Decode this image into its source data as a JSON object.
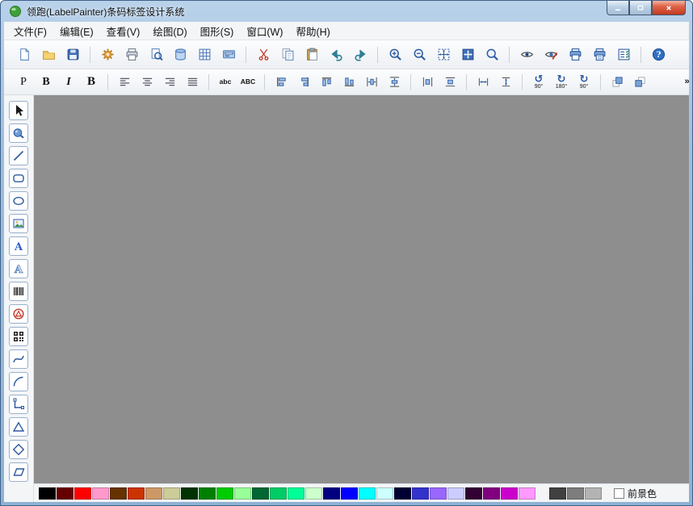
{
  "window": {
    "title": "领跑(LabelPainter)条码标签设计系统",
    "controls": [
      {
        "name": "minimize-button",
        "icon": "minimize"
      },
      {
        "name": "maximize-button",
        "icon": "maximize"
      },
      {
        "name": "close-button",
        "icon": "close"
      }
    ]
  },
  "chevron": {
    "glyph": "»"
  },
  "menu": {
    "items": [
      {
        "name": "menu-file",
        "label": "文件(F)"
      },
      {
        "name": "menu-edit",
        "label": "编辑(E)"
      },
      {
        "name": "menu-view",
        "label": "查看(V)"
      },
      {
        "name": "menu-draw",
        "label": "绘图(D)"
      },
      {
        "name": "menu-shape",
        "label": "图形(S)"
      },
      {
        "name": "menu-window",
        "label": "窗口(W)"
      },
      {
        "name": "menu-help",
        "label": "帮助(H)"
      }
    ]
  },
  "toolbar_main": {
    "groups": [
      [
        {
          "name": "new-button",
          "icon": "page"
        },
        {
          "name": "open-button",
          "icon": "folder"
        },
        {
          "name": "save-button",
          "icon": "floppy"
        }
      ],
      [
        {
          "name": "settings-button",
          "icon": "gear"
        },
        {
          "name": "print-button",
          "icon": "printer"
        },
        {
          "name": "print-preview-button",
          "icon": "preview"
        },
        {
          "name": "database-button",
          "icon": "database"
        },
        {
          "name": "grid-button",
          "icon": "grid"
        },
        {
          "name": "label-printer-button",
          "icon": "device"
        }
      ],
      [
        {
          "name": "cut-button",
          "icon": "cut"
        },
        {
          "name": "copy-button",
          "icon": "copy"
        },
        {
          "name": "paste-button",
          "icon": "paste"
        },
        {
          "name": "undo-button",
          "icon": "undo"
        },
        {
          "name": "redo-button",
          "icon": "redo"
        }
      ],
      [
        {
          "name": "zoom-in-button",
          "icon": "zoomin"
        },
        {
          "name": "zoom-out-button",
          "icon": "zoomout"
        },
        {
          "name": "fit-window-button",
          "icon": "fitwin"
        },
        {
          "name": "fit-page-button",
          "icon": "fitpage"
        },
        {
          "name": "zoom-tool-button",
          "icon": "zoom"
        }
      ],
      [
        {
          "name": "view-mode-button",
          "icon": "eye"
        },
        {
          "name": "edit-mode-button",
          "icon": "eyeedit"
        },
        {
          "name": "print-current-button",
          "icon": "printblue"
        },
        {
          "name": "print-batch-button",
          "icon": "printblue2"
        },
        {
          "name": "print-task-button",
          "icon": "tasklist"
        }
      ],
      [
        {
          "name": "help-button",
          "icon": "help"
        }
      ]
    ]
  },
  "toolbar_format": {
    "groups": [
      [
        {
          "name": "font-properties-button",
          "text": "P"
        },
        {
          "name": "bold-button",
          "text": "B",
          "style": "bold"
        },
        {
          "name": "italic-button",
          "text": "I",
          "style": "italic"
        },
        {
          "name": "black-bold-button",
          "text": "B",
          "style": "heavy"
        }
      ],
      [
        {
          "name": "align-left-button",
          "icon": "alignL"
        },
        {
          "name": "align-center-button",
          "icon": "alignC"
        },
        {
          "name": "align-right-button",
          "icon": "alignR"
        },
        {
          "name": "align-justify-button",
          "icon": "alignJ"
        }
      ],
      [
        {
          "name": "lowercase-button",
          "text": "abc",
          "style": "case"
        },
        {
          "name": "uppercase-button",
          "text": "ABC",
          "style": "case"
        }
      ],
      [
        {
          "name": "align-objects-left-button",
          "icon": "objL"
        },
        {
          "name": "align-objects-right-button",
          "icon": "objR"
        },
        {
          "name": "align-objects-top-button",
          "icon": "objT"
        },
        {
          "name": "align-objects-bottom-button",
          "icon": "objB"
        },
        {
          "name": "space-equal-horizontal-button",
          "icon": "spaceH"
        },
        {
          "name": "space-equal-vertical-button",
          "icon": "spaceV"
        }
      ],
      [
        {
          "name": "page-center-horizontal-button",
          "icon": "pageH"
        },
        {
          "name": "page-center-vertical-button",
          "icon": "pageV"
        }
      ],
      [
        {
          "name": "equal-width-button",
          "icon": "eqW"
        },
        {
          "name": "equal-height-button",
          "icon": "eqH"
        }
      ],
      [
        {
          "name": "rotate-left-90-button",
          "icon": "rotL",
          "label": "90°"
        },
        {
          "name": "rotate-180-button",
          "icon": "rot180",
          "label": "180°"
        },
        {
          "name": "rotate-right-90-button",
          "icon": "rotR",
          "label": "90°"
        }
      ],
      [
        {
          "name": "bring-to-front-button",
          "icon": "front"
        },
        {
          "name": "send-to-back-button",
          "icon": "back"
        }
      ]
    ]
  },
  "tools": {
    "items": [
      {
        "name": "select-tool",
        "icon": "cursor"
      },
      {
        "name": "rotate-tool",
        "icon": "blob"
      },
      {
        "name": "line-tool",
        "icon": "line"
      },
      {
        "name": "rounded-rect-tool",
        "icon": "roundrect"
      },
      {
        "name": "ellipse-tool",
        "icon": "ellipse"
      },
      {
        "name": "image-tool",
        "icon": "image"
      },
      {
        "name": "text-tool",
        "icon": "textA"
      },
      {
        "name": "art-text-tool",
        "icon": "artA"
      },
      {
        "name": "barcode-tool",
        "icon": "barcode"
      },
      {
        "name": "logo-tool",
        "icon": "logo"
      },
      {
        "name": "qrcode-tool",
        "icon": "qrcode"
      },
      {
        "name": "curve-tool",
        "icon": "curve"
      },
      {
        "name": "arc-tool",
        "icon": "arc"
      },
      {
        "name": "polyline-tool",
        "icon": "polyline"
      },
      {
        "name": "triangle-tool",
        "icon": "triangle"
      },
      {
        "name": "diamond-tool",
        "icon": "diamond"
      },
      {
        "name": "parallelogram-tool",
        "icon": "parallelogram"
      }
    ]
  },
  "canvas": {
    "background": "#8e8e8e"
  },
  "palette": {
    "colors": [
      "#000000",
      "#660000",
      "#ff0000",
      "#ff99cc",
      "#663300",
      "#cc3300",
      "#cc9966",
      "#cccc99",
      "#003300",
      "#008000",
      "#00cc00",
      "#99ff99",
      "#006633",
      "#00cc66",
      "#00ff99",
      "#ccffcc",
      "#000080",
      "#0000ff",
      "#00ffff",
      "#ccffff",
      "#000033",
      "#3333cc",
      "#9966ff",
      "#ccccff",
      "#330033",
      "#800080",
      "#cc00cc",
      "#ff99ff"
    ],
    "grays": [
      "#404040",
      "#7d7d7d",
      "#b3b3b3"
    ],
    "foreground_label": "前景色"
  }
}
